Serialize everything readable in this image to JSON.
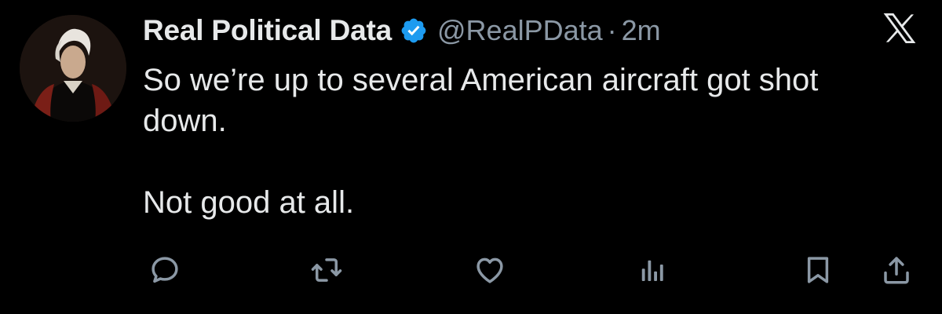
{
  "tweet": {
    "author_name": "Real Political Data",
    "handle": "@RealPData",
    "separator": "·",
    "time": "2m",
    "text": "So we’re up to several American aircraft got shot\ndown.\n\nNot good at all.",
    "verified": true
  },
  "icons": {
    "verified": "verified-badge-icon",
    "brand": "x-logo-icon",
    "reply": "reply-icon",
    "retweet": "retweet-icon",
    "like": "heart-icon",
    "views": "views-icon",
    "bookmark": "bookmark-icon",
    "share": "share-icon"
  },
  "colors": {
    "background": "#000000",
    "text": "#e7e9ea",
    "secondary": "#8b98a5",
    "verified": "#1d9bf0"
  }
}
